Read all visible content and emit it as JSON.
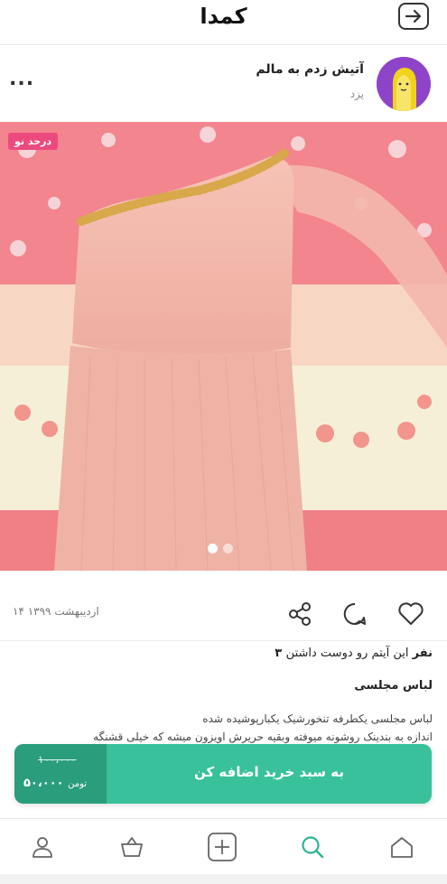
{
  "app": {
    "logo": "کمدا"
  },
  "seller": {
    "name": "آتیش زدم به مالم",
    "city": "یزد",
    "more": "..."
  },
  "post": {
    "badge": "درحد نو",
    "date": "۱۴ اردیبهشت ۱۳۹۹",
    "likes_count": "۳ نفر",
    "likes_text": "این آیتم رو دوست داشتن",
    "title": "لباس مجلسی",
    "description_line1": "لباس مجلسی یکطرفه تنخورشیک یکبارپوشیده شده",
    "description_line2": "اندازه به بندینک روشونه میوفته وبقیه حریرش اویزون میشه که خیلی قشنگه",
    "image_count": 2,
    "active_image": 1
  },
  "cart": {
    "old_price": "۱۰۰،۰۰۰",
    "new_price": "۵۰،۰۰۰",
    "currency": "تومن",
    "button_label": "به سبد خرید اضافه کن"
  },
  "nav": [
    "profile-icon",
    "basket-icon",
    "add-icon",
    "search-icon",
    "home-icon"
  ],
  "colors": {
    "accent": "#38c19b",
    "accent_dark": "#2a9d7d",
    "badge": "#ec4a7f",
    "active_nav": "#2eb393"
  }
}
